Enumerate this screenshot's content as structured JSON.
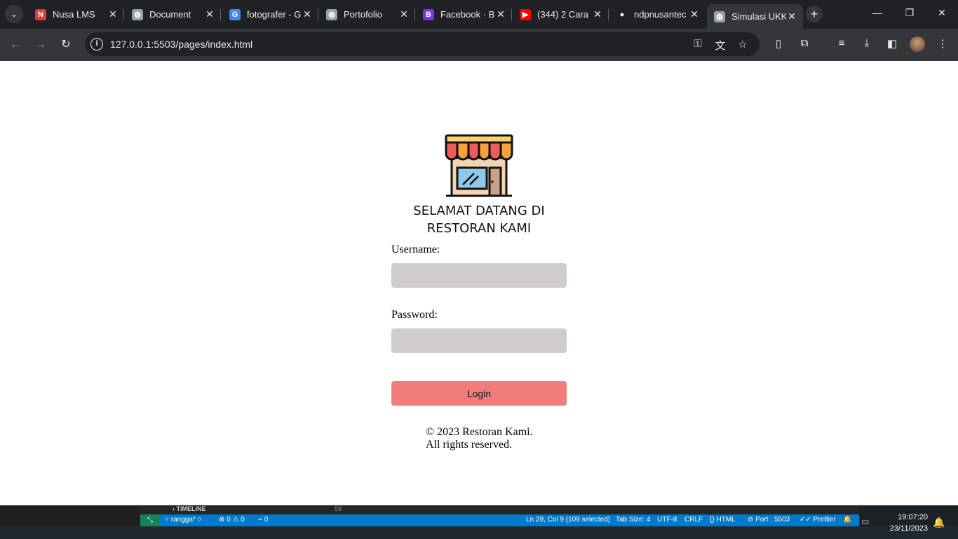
{
  "browser": {
    "tabs": [
      {
        "title": "Nusa LMS",
        "favicon": "n-red-icon",
        "color": "#e53935",
        "glyph": "N"
      },
      {
        "title": "Document",
        "favicon": "globe-icon",
        "color": "#9aa0a6",
        "glyph": "◍"
      },
      {
        "title": "fotografer - G",
        "favicon": "google-icon",
        "color": "#4285f4",
        "glyph": "G"
      },
      {
        "title": "Portofolio",
        "favicon": "globe-icon",
        "color": "#9aa0a6",
        "glyph": "◍"
      },
      {
        "title": "Facebook · B",
        "favicon": "bootstrap-icon",
        "color": "#7b2ff7",
        "glyph": "B"
      },
      {
        "title": "(344) 2 Cara",
        "favicon": "youtube-icon",
        "color": "#ff0000",
        "glyph": "▶"
      },
      {
        "title": "ndpnusantec",
        "favicon": "github-icon",
        "color": "#202124",
        "glyph": "●"
      },
      {
        "title": "Simulasi UKK",
        "favicon": "globe-icon",
        "color": "#9aa0a6",
        "glyph": "◍",
        "active": true
      }
    ],
    "url": "127.0.0.1:5503/pages/index.html"
  },
  "page": {
    "heading_line1": "SELAMAT DATANG DI",
    "heading_line2": "RESTORAN KAMI",
    "username_label": "Username:",
    "username_value": "",
    "password_label": "Password:",
    "password_value": "",
    "login_label": "Login",
    "footer_line1": "© 2023 Restoran Kami.",
    "footer_line2": "All rights reserved.",
    "colors": {
      "input_bg": "#d0cccc",
      "button_bg": "#f07c7c"
    }
  },
  "vscode": {
    "timeline_label": "TIMELINE",
    "line_number": "59",
    "status": {
      "branch": "rangga*",
      "errors": "0",
      "warnings": "0",
      "ports": "0",
      "cursor": "Ln 29, Col 9 (109 selected)",
      "tab_size": "Tab Size: 4",
      "encoding": "UTF-8",
      "eol": "CRLF",
      "language": "HTML",
      "port": "Port : 5503",
      "formatter": "Prettier"
    }
  },
  "system": {
    "time": "19:07:20",
    "date": "23/11/2023"
  }
}
